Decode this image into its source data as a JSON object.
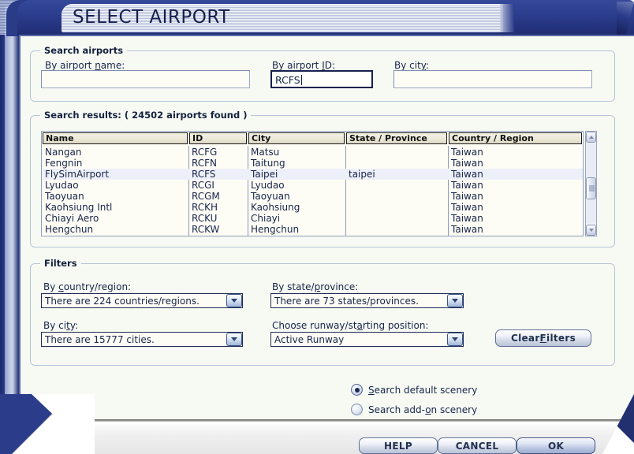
{
  "window": {
    "title": "SELECT AIRPORT"
  },
  "search_airports": {
    "legend": "Search airports",
    "by_name_label": "By airport name:",
    "by_name_value": "",
    "by_id_label": "By airport ID:",
    "by_id_value": "RCFS",
    "by_city_label": "By city:",
    "by_city_value": ""
  },
  "search_results": {
    "legend": "Search results: ( 24502 airports found )",
    "columns": [
      "Name",
      "ID",
      "City",
      "State / Province",
      "Country / Region"
    ],
    "rows": [
      {
        "name": "Nangan",
        "id": "RCFG",
        "city": "Matsu",
        "state": "",
        "country": "Taiwan",
        "selected": false
      },
      {
        "name": "Fengnin",
        "id": "RCFN",
        "city": "Taitung",
        "state": "",
        "country": "Taiwan",
        "selected": false
      },
      {
        "name": "FlySimAirport",
        "id": "RCFS",
        "city": "Taipei",
        "state": "taipei",
        "country": "Taiwan",
        "selected": true
      },
      {
        "name": "Lyudao",
        "id": "RCGI",
        "city": "Lyudao",
        "state": "",
        "country": "Taiwan",
        "selected": false
      },
      {
        "name": "Taoyuan",
        "id": "RCGM",
        "city": "Taoyuan",
        "state": "",
        "country": "Taiwan",
        "selected": false
      },
      {
        "name": "Kaohsiung Intl",
        "id": "RCKH",
        "city": "Kaohsiung",
        "state": "",
        "country": "Taiwan",
        "selected": false
      },
      {
        "name": "Chiayi Aero",
        "id": "RCKU",
        "city": "Chiayi",
        "state": "",
        "country": "Taiwan",
        "selected": false
      },
      {
        "name": "Hengchun",
        "id": "RCKW",
        "city": "Hengchun",
        "state": "",
        "country": "Taiwan",
        "selected": false
      }
    ],
    "scrollbar": {
      "up_icon": "scroll-up-arrow",
      "down_icon": "scroll-down-arrow"
    }
  },
  "filters": {
    "legend": "Filters",
    "country_label": "By country/region:",
    "country_value": "There are 224 countries/regions.",
    "state_label": "By state/province:",
    "state_value": "There are 73 states/provinces.",
    "city_label": "By city:",
    "city_value": "There are 15777 cities.",
    "runway_label": "Choose runway/starting position:",
    "runway_value": "Active Runway",
    "clear_button": "Clear Filters"
  },
  "scenery": {
    "default_label": "Search default scenery",
    "addon_label": "Search add-on scenery",
    "selected": "default"
  },
  "footer": {
    "help": "HELP",
    "cancel": "CANCEL",
    "ok": "OK"
  },
  "colors": {
    "frame_blue": "#2b3c8c",
    "dialog_bg": "#f7faf3",
    "text": "#17244a",
    "header_bg": "#ece8d7",
    "selected_row": "#edf0f8"
  }
}
